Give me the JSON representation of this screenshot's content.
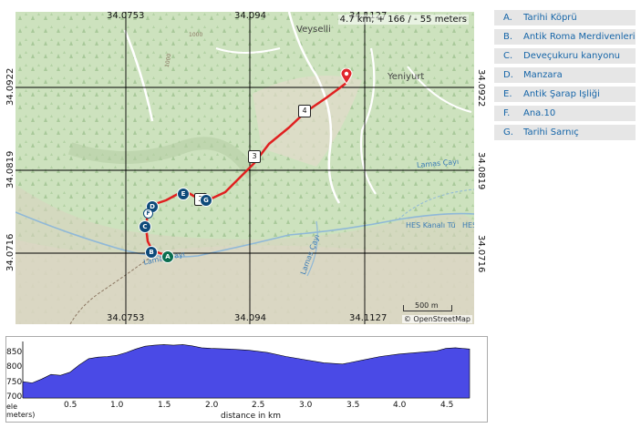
{
  "map": {
    "info": "4.7 km, + 166 / - 55 meters",
    "attribution": "© OpenStreetMap",
    "scale_label": "500 m",
    "coords_top": [
      "34.0753",
      "34.094",
      "34.1127"
    ],
    "coords_bottom": [
      "34.0753",
      "34.094",
      "34.1127"
    ],
    "coords_left": [
      "34.0922",
      "34.0819",
      "34.0716"
    ],
    "coords_right": [
      "34.0922",
      "34.0819",
      "34.0716"
    ],
    "place_labels": {
      "veyselli": "Veyselli",
      "yeniyurt": "Yeniyurt",
      "stream1": "Lamas Çayı",
      "stream2": "Lamas Çayı",
      "stream3": "Lamas Çayı",
      "hes1": "HES Kanalı Tü",
      "hes2": "HES",
      "contour1": "1000",
      "contour2": "1000"
    },
    "km_markers": [
      "2",
      "3",
      "4"
    ],
    "waypoints": [
      "A",
      "B",
      "C",
      "D",
      "E",
      "G",
      "F"
    ],
    "route_color": "#e02020",
    "pin_color": "#e0252b"
  },
  "legend": [
    {
      "letter": "A.",
      "name": "Tarihi Köprü"
    },
    {
      "letter": "B.",
      "name": "Antik Roma Merdivenleri"
    },
    {
      "letter": "C.",
      "name": "Deveçukuru kanyonu"
    },
    {
      "letter": "D.",
      "name": "Manzara"
    },
    {
      "letter": "E.",
      "name": "Antik Şarap İşliği"
    },
    {
      "letter": "F.",
      "name": "Ana.10"
    },
    {
      "letter": "G.",
      "name": "Tarihi Sarnıç"
    }
  ],
  "profile": {
    "y_ticks": [
      "850",
      "800",
      "750",
      "700"
    ],
    "x_ticks": [
      "0.5",
      "1.0",
      "1.5",
      "2.0",
      "2.5",
      "3.0",
      "3.5",
      "4.0",
      "4.5"
    ],
    "ylabel_line1": "ele",
    "ylabel_line2": "meters)",
    "xlabel": "distance in km",
    "fill_color": "#4a4ae6"
  },
  "chart_data": {
    "type": "area",
    "title": "",
    "xlabel": "distance in km",
    "ylabel": "ele meters)",
    "xlim": [
      0,
      4.75
    ],
    "ylim": [
      700,
      880
    ],
    "x": [
      0,
      0.1,
      0.2,
      0.3,
      0.4,
      0.5,
      0.6,
      0.7,
      0.8,
      0.9,
      1.0,
      1.1,
      1.2,
      1.3,
      1.4,
      1.5,
      1.6,
      1.7,
      1.8,
      1.9,
      2.0,
      2.2,
      2.4,
      2.6,
      2.8,
      3.0,
      3.2,
      3.4,
      3.6,
      3.8,
      4.0,
      4.2,
      4.4,
      4.5,
      4.6,
      4.75
    ],
    "series": [
      {
        "values": [
          752,
          748,
          760,
          775,
          772,
          782,
          805,
          825,
          830,
          832,
          836,
          845,
          856,
          865,
          868,
          870,
          868,
          870,
          866,
          860,
          858,
          856,
          852,
          845,
          832,
          822,
          812,
          808,
          820,
          832,
          840,
          845,
          850,
          858,
          860,
          856
        ]
      }
    ],
    "grid": false
  }
}
